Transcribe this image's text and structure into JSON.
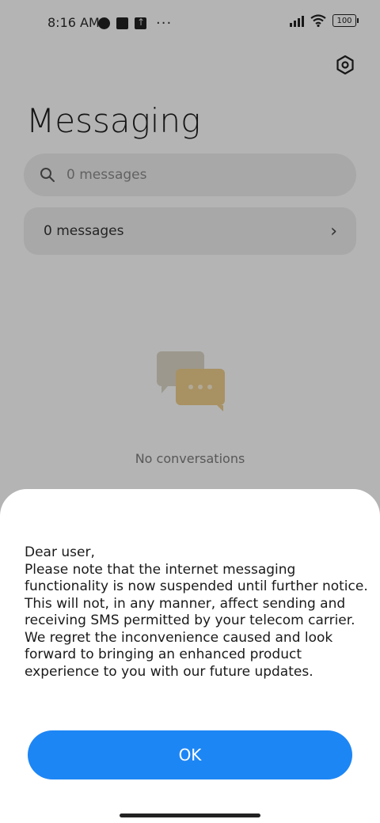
{
  "status_bar": {
    "time": "8:16 AM",
    "battery": "100",
    "icons": [
      "notification-round-icon",
      "notification-square-icon",
      "upload-icon",
      "more-dots-icon",
      "signal-icon",
      "wifi-icon",
      "battery-icon"
    ],
    "more": "···"
  },
  "header": {
    "title": "Messaging",
    "settings_icon": "hexagon-settings-icon"
  },
  "search": {
    "placeholder": "0 messages",
    "value": ""
  },
  "messages_row": {
    "label": "0 messages",
    "chevron": "›"
  },
  "empty_state": {
    "text": "No conversations"
  },
  "dialog": {
    "message": "Dear user,\nPlease note that the internet messaging functionality is now suspended until further notice. This will not, in any manner, affect sending and receiving SMS permitted by your telecom carrier. We regret the inconvenience caused and look forward to bringing an enhanced product experience to you with our future updates.",
    "ok_label": "OK"
  },
  "colors": {
    "accent": "#1d86f5",
    "background": "#fafafa",
    "card": "#e9e9e9",
    "illustration_back": "#d9d3c4",
    "illustration_front": "#e9c98a"
  }
}
